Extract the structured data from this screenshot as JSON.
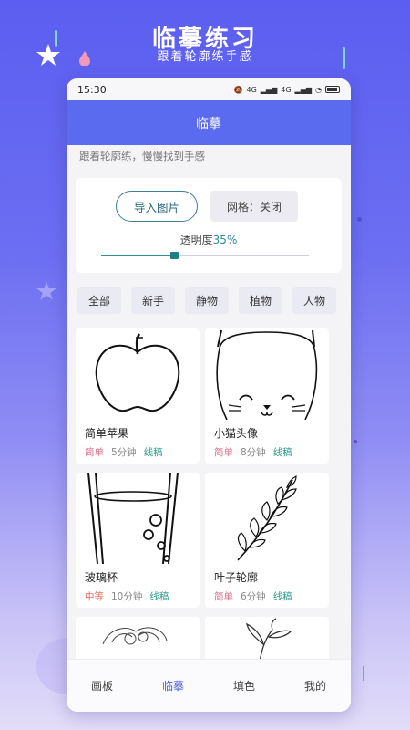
{
  "promo": {
    "title": "临摹练习",
    "subtitle": "跟着轮廓练手感"
  },
  "status_bar": {
    "time": "15:30",
    "signal1": "4G",
    "signal2": "4G"
  },
  "header": {
    "title": "临摹"
  },
  "hint": "跟着轮廓练，慢慢找到手感",
  "controls": {
    "import_label": "导入图片",
    "grid_label": "网格：关闭",
    "opacity_label": "透明度",
    "opacity_value": "35%",
    "opacity_fraction": 0.35
  },
  "filters": [
    "全部",
    "新手",
    "静物",
    "植物",
    "人物"
  ],
  "cards": [
    {
      "title": "简单苹果",
      "level": "简单",
      "duration": "5分钟",
      "kind": "线稿"
    },
    {
      "title": "小猫头像",
      "level": "简单",
      "duration": "8分钟",
      "kind": "线稿"
    },
    {
      "title": "玻璃杯",
      "level": "中等",
      "duration": "10分钟",
      "kind": "线稿"
    },
    {
      "title": "叶子轮廓",
      "level": "简单",
      "duration": "6分钟",
      "kind": "线稿"
    }
  ],
  "tabs": [
    {
      "label": "画板",
      "active": false
    },
    {
      "label": "临摹",
      "active": true
    },
    {
      "label": "填色",
      "active": false
    },
    {
      "label": "我的",
      "active": false
    }
  ],
  "colors": {
    "header": "#5a6bef",
    "accent": "#2f8c96",
    "active_tab": "#4d5ae6"
  }
}
